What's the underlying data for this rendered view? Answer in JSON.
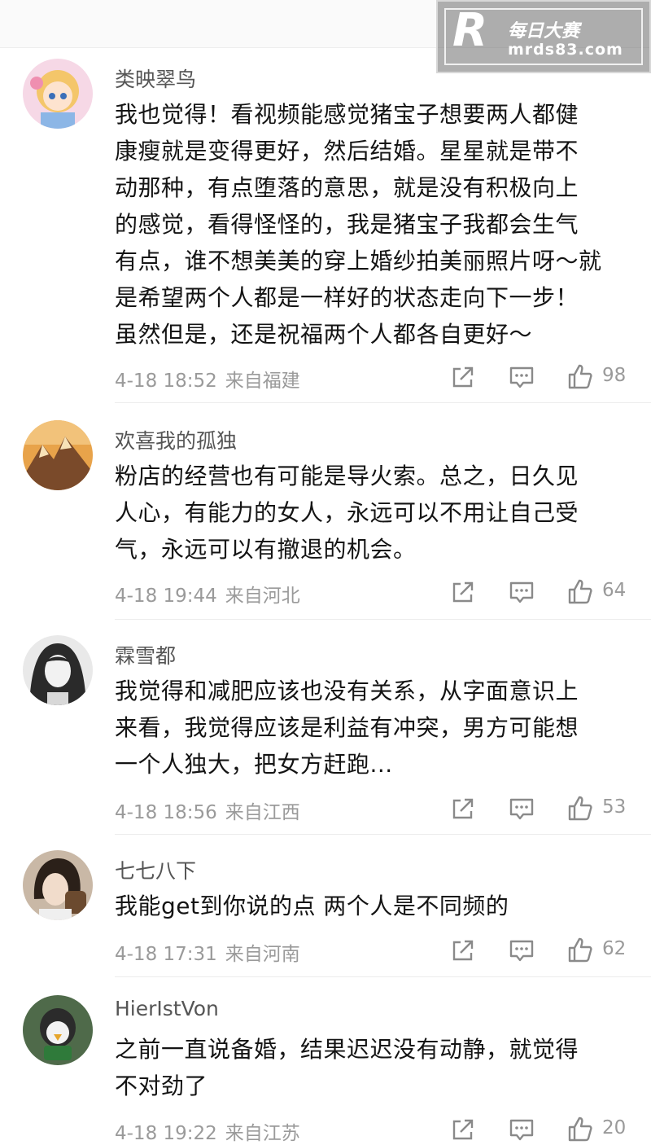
{
  "watermark": {
    "logo": "R",
    "title": "每日大赛",
    "url": "mrds83.com"
  },
  "comments": [
    {
      "username": "类映翠鸟",
      "text": "我也觉得！看视频能感觉猪宝子想要两人都健\n康瘦就是变得更好，然后结婚。星星就是带不\n动那种，有点堕落的意思，就是没有积极向上\n的感觉，看得怪怪的，我是猪宝子我都会生气\n有点，谁不想美美的穿上婚纱拍美丽照片呀～就\n是希望两个人都是一样好的状态走向下一步！\n虽然但是，还是祝福两个人都各自更好～",
      "date": "4-18 18:52",
      "location": "来自福建",
      "likes": "98"
    },
    {
      "username": "欢喜我的孤独",
      "text": "粉店的经营也有可能是导火索。总之，日久见\n人心，有能力的女人，永远可以不用让自己受\n气，永远可以有撤退的机会。",
      "date": "4-18 19:44",
      "location": "来自河北",
      "likes": "64"
    },
    {
      "username": "霖雪都",
      "text": "我觉得和减肥应该也没有关系，从字面意识上\n来看，我觉得应该是利益有冲突，男方可能想\n一个人独大，把女方赶跑...",
      "date": "4-18 18:56",
      "location": "来自江西",
      "likes": "53"
    },
    {
      "username": "七七八下",
      "text": "我能get到你说的点 两个人是不同频的",
      "date": "4-18 17:31",
      "location": "来自河南",
      "likes": "62"
    },
    {
      "username": "HierIstVon",
      "text": "之前一直说备婚，结果迟迟没有动静，就觉得\n不对劲了",
      "date": "4-18 19:22",
      "location": "来自江苏",
      "likes": "20"
    }
  ]
}
